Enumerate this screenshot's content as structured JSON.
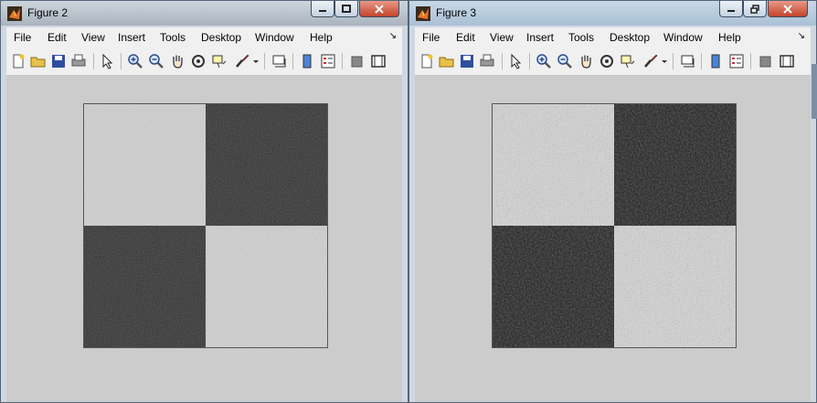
{
  "windows": [
    {
      "title": "Figure 2",
      "menu": [
        "File",
        "Edit",
        "View",
        "Insert",
        "Tools",
        "Desktop",
        "Window",
        "Help"
      ],
      "image": {
        "light": "#d0d0d0",
        "dark": "#2e2e2e"
      }
    },
    {
      "title": "Figure 3",
      "menu": [
        "File",
        "Edit",
        "View",
        "Insert",
        "Tools",
        "Desktop",
        "Window",
        "Help"
      ],
      "image": {
        "light": "#d2d2d2",
        "dark": "#1f1f1f"
      }
    }
  ],
  "toolbar_icons": [
    "new-figure-icon",
    "open-file-icon",
    "save-icon",
    "print-icon",
    "edit-plot-arrow-icon",
    "zoom-in-icon",
    "zoom-out-icon",
    "pan-hand-icon",
    "rotate-3d-icon",
    "data-cursor-icon",
    "brush-icon",
    "brush-dropdown-icon",
    "link-plot-icon",
    "insert-colorbar-icon",
    "insert-legend-icon",
    "hide-plot-tools-icon",
    "show-plot-tools-icon"
  ],
  "colors": {
    "canvas": "#cccccc",
    "menubar": "#f0f0f0",
    "close_button": "#c4432d"
  }
}
